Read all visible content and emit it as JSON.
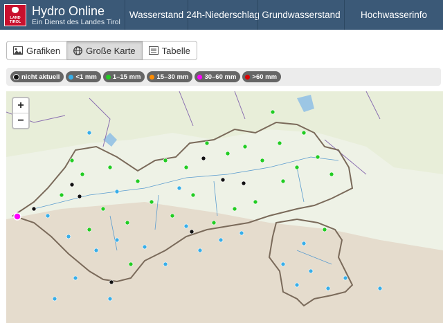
{
  "brand": {
    "title": "Hydro Online",
    "subtitle": "Ein Dienst des Landes Tirol",
    "logo_text_1": "LAND",
    "logo_text_2": "TIROL"
  },
  "nav": [
    {
      "label": "Wasserstand"
    },
    {
      "label": "24h-Niederschlag"
    },
    {
      "label": "Grundwasserstand"
    },
    {
      "label": "Hochwasserinfo"
    }
  ],
  "views": [
    {
      "label": "Grafiken",
      "icon": "image-icon",
      "active": false
    },
    {
      "label": "Große Karte",
      "icon": "globe-icon",
      "active": true
    },
    {
      "label": "Tabelle",
      "icon": "table-icon",
      "active": false
    }
  ],
  "legend": [
    {
      "label": "nicht aktuell",
      "color": "#111111"
    },
    {
      "label": "<1 mm",
      "color": "#38aee8"
    },
    {
      "label": "1–15 mm",
      "color": "#22cc22"
    },
    {
      "label": "15–30 mm",
      "color": "#ff8c00"
    },
    {
      "label": "30–60 mm",
      "color": "#ff00ff"
    },
    {
      "label": ">60 mm",
      "color": "#dd0000"
    }
  ],
  "map": {
    "zoom_in": "+",
    "zoom_out": "−"
  }
}
